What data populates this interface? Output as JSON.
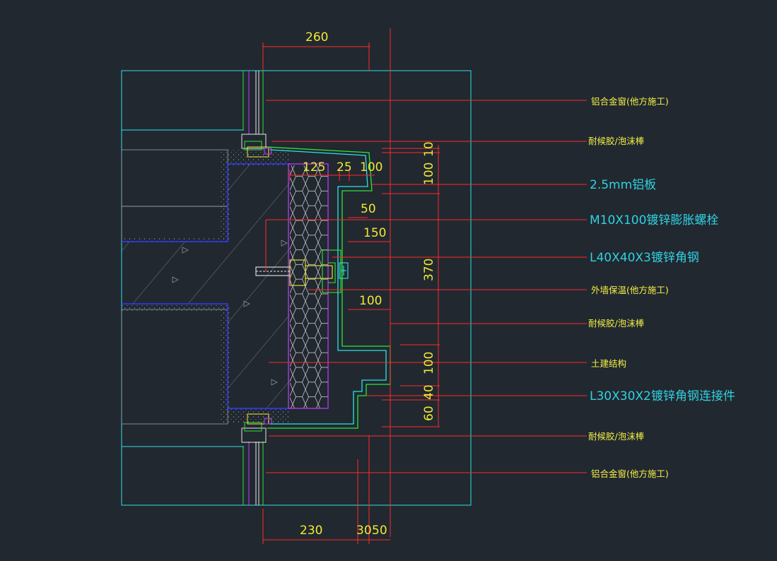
{
  "dimensions": {
    "top_260": "260",
    "d_125": "125",
    "d_25": "25",
    "d_100_a": "100",
    "d_50": "50",
    "d_150": "150",
    "d_100_b": "100",
    "v_10": "10",
    "v_100_a": "100",
    "v_370": "370",
    "v_100_b": "100",
    "v_40": "40",
    "v_60": "60",
    "bottom_230": "230",
    "bottom_30": "30",
    "bottom_50": "50"
  },
  "labels": {
    "alu_window_top": "铝合金窗(他方施工)",
    "sealant_1": "耐候胶/泡沫棒",
    "alu_panel": "2.5mm铝板",
    "bolt": "M10X100镀锌膨胀螺栓",
    "angle_steel": "L40X40X3镀锌角钢",
    "insulation": "外墙保温(他方施工)",
    "sealant_2": "耐候胶/泡沫棒",
    "civil_structure": "土建结构",
    "connector": "L30X30X2镀锌角钢连接件",
    "sealant_3": "耐候胶/泡沫棒",
    "alu_window_bottom": "铝合金窗(他方施工)"
  },
  "colors": {
    "background": "#212830",
    "dimension_line": "#ff2a2a",
    "dimension_text": "#f2e933",
    "outline_cyan": "#2ee0e6",
    "aluminum_green": "#2fe33a",
    "structure_blue": "#2f3cff",
    "insulation_magenta": "#c43cff",
    "steel_yellow": "#f2e933"
  }
}
